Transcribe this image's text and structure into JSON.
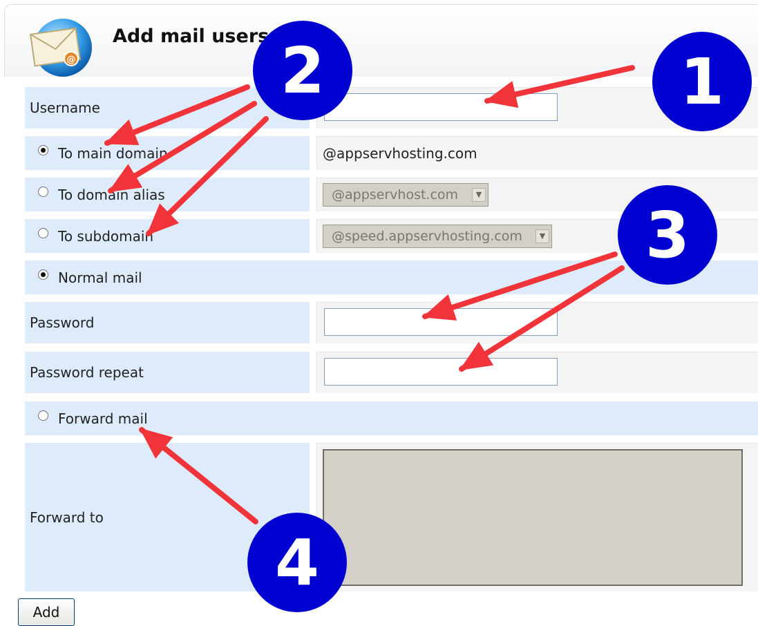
{
  "header": {
    "title": "Add mail users",
    "icon": "mail-envelope-icon"
  },
  "form": {
    "username_label": "Username",
    "to_main_domain_label": "To main domain",
    "main_domain": "@appservhosting.com",
    "to_domain_alias_label": "To domain alias",
    "domain_alias_selected": "@appservhost.com",
    "to_subdomain_label": "To subdomain",
    "subdomain_selected": "@speed.appservhosting.com",
    "normal_mail_label": "Normal mail",
    "password_label": "Password",
    "password_repeat_label": "Password repeat",
    "forward_mail_label": "Forward mail",
    "forward_to_label": "Forward to",
    "add_button": "Add",
    "selected_destination": "To main domain",
    "selected_mode": "Normal mail"
  },
  "annotations": {
    "badges": [
      "1",
      "2",
      "3",
      "4"
    ],
    "badge_color": "#0000d0",
    "arrow_color": "#f0343a"
  },
  "colors": {
    "label_bg": "#deebfb",
    "value_bg": "#f4f4f4",
    "input_border": "#7f9db9",
    "disabled_bg": "#d4d0c8"
  }
}
